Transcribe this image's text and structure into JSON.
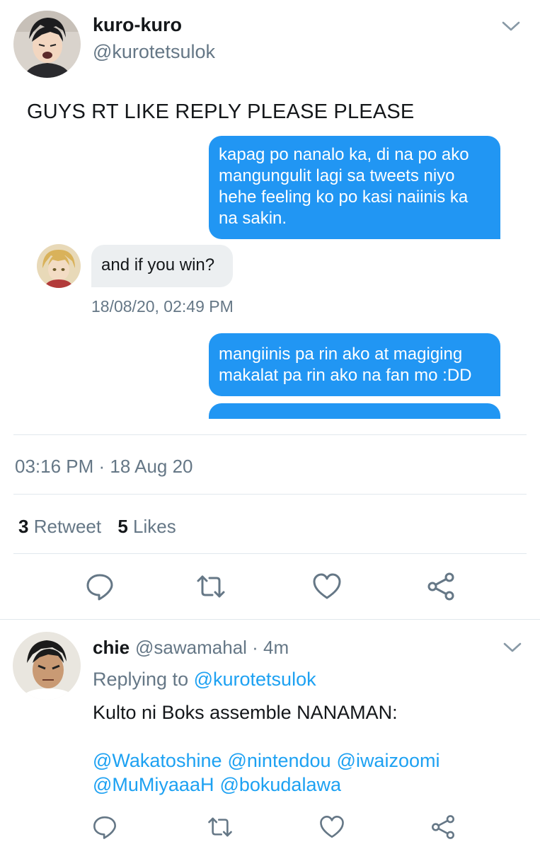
{
  "tweet": {
    "author_name": "kuro-kuro",
    "author_handle": "@kurotetsulok",
    "text": "GUYS RT LIKE REPLY PLEASE PLEASE",
    "timestamp": "03:16 PM · 18 Aug 20",
    "retweet_count": "3",
    "retweet_label": "Retweet",
    "like_count": "5",
    "like_label": "Likes",
    "media_chat": {
      "message_1": "kapag po nanalo ka, di na po ako mangungulit lagi sa tweets niyo hehe feeling ko po kasi naiinis ka na sakin.",
      "message_2": "and if you win?",
      "message_2_time": "18/08/20, 02:49 PM",
      "message_3": "mangiinis pa rin ako at magiging makalat pa rin ako na fan mo :DD"
    }
  },
  "reply": {
    "author_name": "chie",
    "author_handle": "@sawamahal",
    "time_ago": "· 4m",
    "replying_label": "Replying to",
    "replying_to": "@kurotetsulok",
    "text": "Kulto ni Boks assemble NANAMAN:",
    "mentions": [
      "@Wakatoshine",
      "@nintendou",
      "@iwaizoomi",
      "@MuMiyaaaH",
      "@bokudalawa"
    ]
  },
  "icons": {
    "reply": "speech-bubble-icon",
    "retweet": "retweet-arrows-icon",
    "like": "heart-icon",
    "share": "share-nodes-icon",
    "menu": "chevron-down-icon"
  },
  "colors": {
    "accent": "#1da1f2",
    "bubble_outgoing": "#2196f3",
    "bubble_incoming": "#eceff1",
    "secondary_text": "#657786",
    "icon_gray": "#657786"
  }
}
